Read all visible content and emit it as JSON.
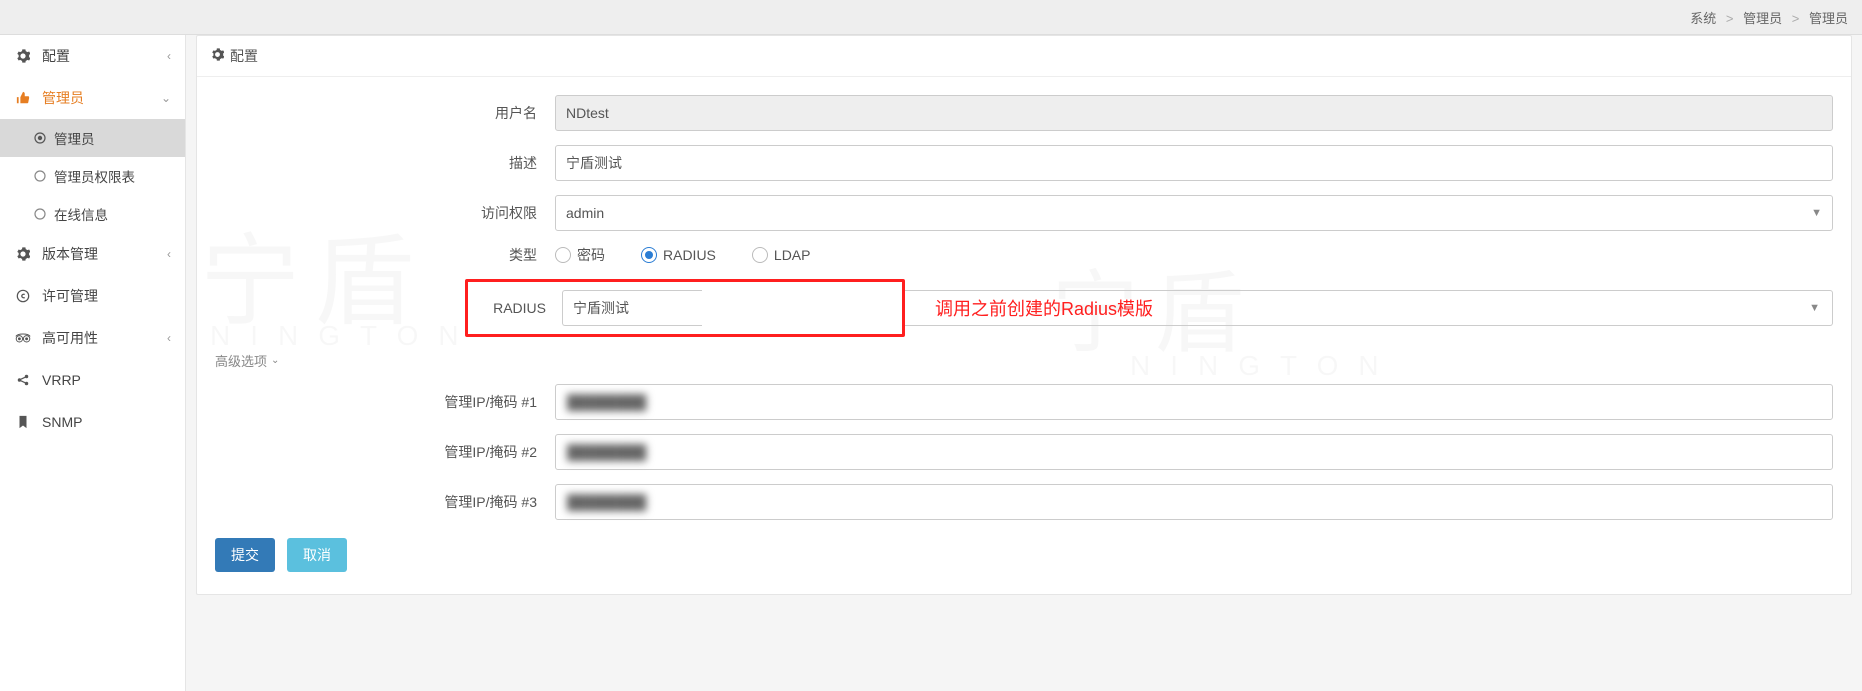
{
  "breadcrumb": {
    "a": "系统",
    "b": "管理员",
    "c": "管理员",
    "sep": ">"
  },
  "sidebar": {
    "config": "配置",
    "admin": "管理员",
    "admin_sub": {
      "admin": "管理员",
      "perm": "管理员权限表",
      "online": "在线信息"
    },
    "version": "版本管理",
    "license": "许可管理",
    "ha": "高可用性",
    "vrrp": "VRRP",
    "snmp": "SNMP"
  },
  "panel": {
    "title": "配置"
  },
  "form": {
    "username_label": "用户名",
    "username_value": "NDtest",
    "desc_label": "描述",
    "desc_value": "宁盾测试",
    "perm_label": "访问权限",
    "perm_value": "admin",
    "type_label": "类型",
    "type_options": {
      "password": "密码",
      "radius": "RADIUS",
      "ldap": "LDAP"
    },
    "type_selected": "radius",
    "radius_label": "RADIUS",
    "radius_value": "宁盾测试",
    "annotation": "调用之前创建的Radius模版",
    "adv_options": "高级选项",
    "ip1_label": "管理IP/掩码 #1",
    "ip2_label": "管理IP/掩码 #2",
    "ip3_label": "管理IP/掩码 #3",
    "ip_masked": "████████",
    "submit": "提交",
    "cancel": "取消"
  },
  "watermark": {
    "glyph": "宁盾",
    "latin": "NINGTON"
  }
}
